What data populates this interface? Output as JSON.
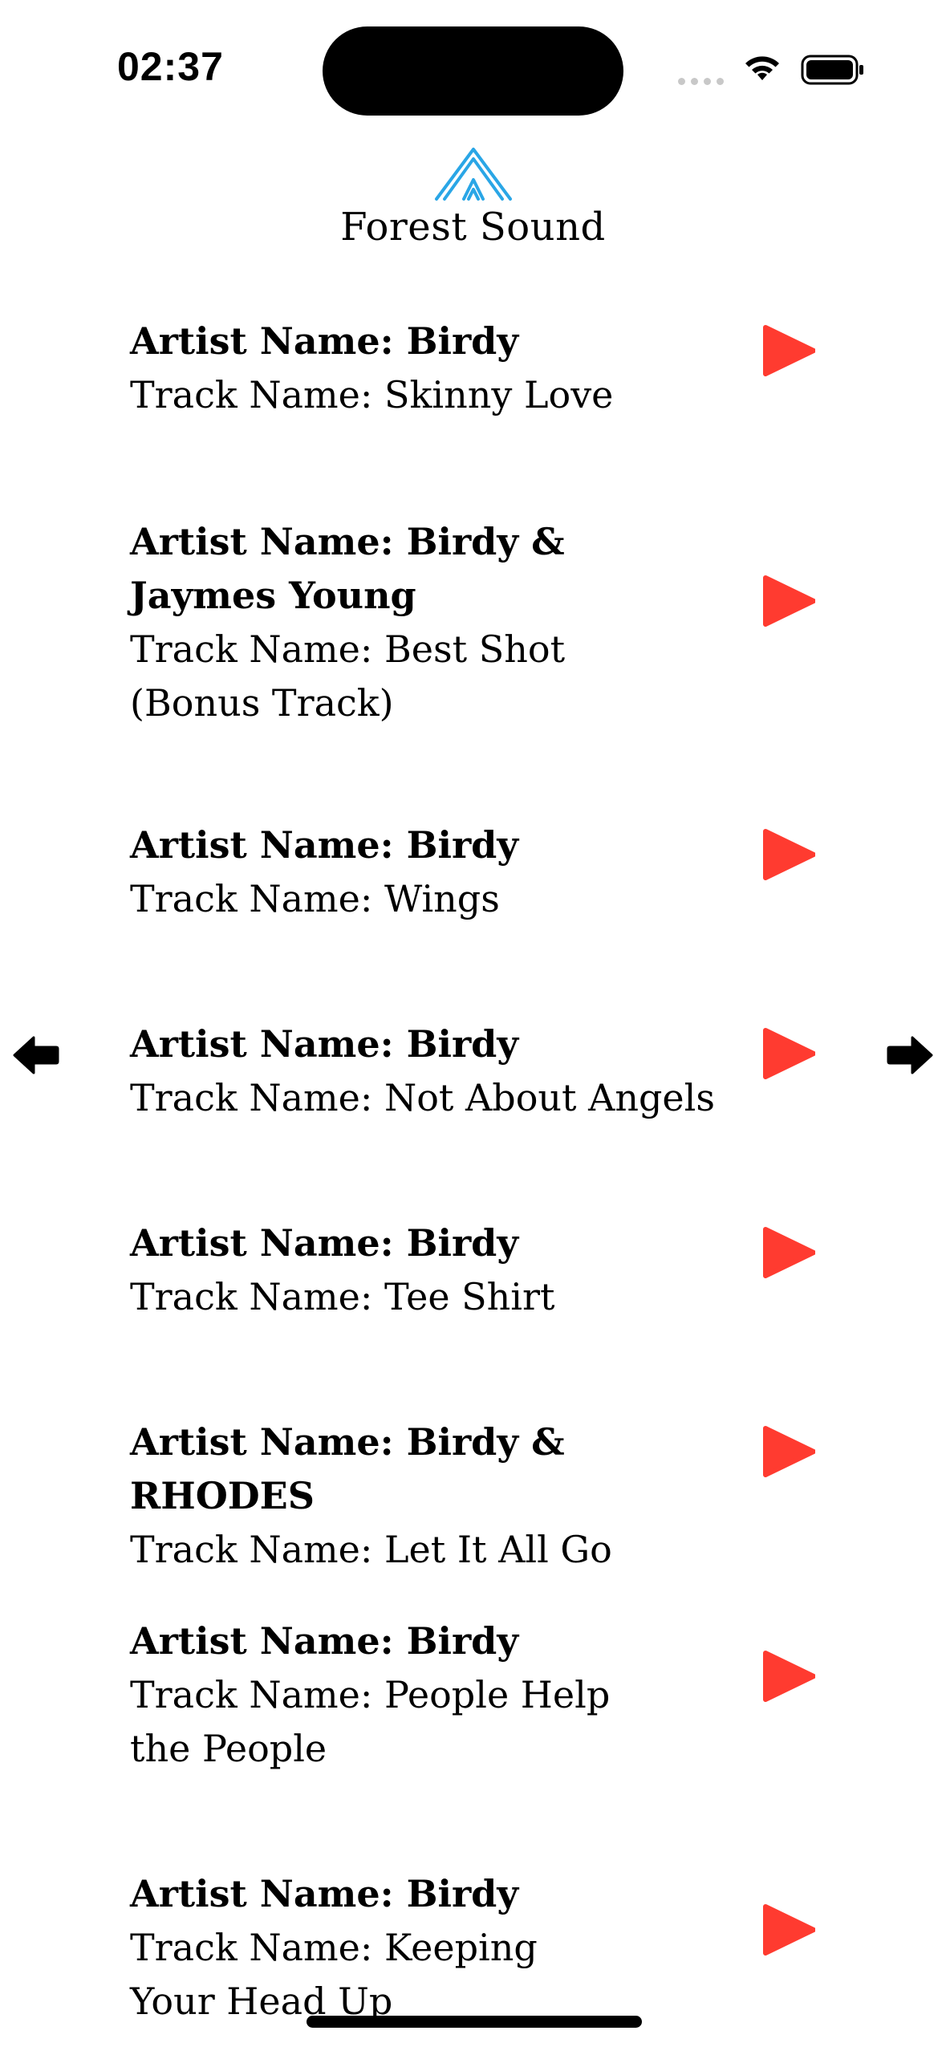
{
  "status_bar": {
    "time": "02:37"
  },
  "header": {
    "logo_icon": "tent-icon",
    "title": "Forest Sound"
  },
  "colors": {
    "play_button": "#ff3b30",
    "logo": "#2aa6e6"
  },
  "tracks": [
    {
      "artist": "Artist Name: Birdy",
      "track": "Track Name: Skinny Love"
    },
    {
      "artist": "Artist Name: Birdy & Jaymes Young",
      "track": "Track Name: Best Shot (Bonus Track)"
    },
    {
      "artist": "Artist Name: Birdy",
      "track": "Track Name: Wings"
    },
    {
      "artist": "Artist Name: Birdy",
      "track": "Track Name: Not About Angels"
    },
    {
      "artist": "Artist Name: Birdy",
      "track": "Track Name: Tee Shirt"
    },
    {
      "artist": "Artist Name: Birdy & RHODES",
      "track": "Track Name: Let It All Go"
    },
    {
      "artist": "Artist Name: Birdy",
      "track": "Track Name: People Help the People"
    },
    {
      "artist": "Artist Name: Birdy",
      "track": "Track Name: Keeping Your Head Up"
    }
  ],
  "navigation": {
    "previous_icon": "arrow-left-icon",
    "next_icon": "arrow-right-icon"
  }
}
